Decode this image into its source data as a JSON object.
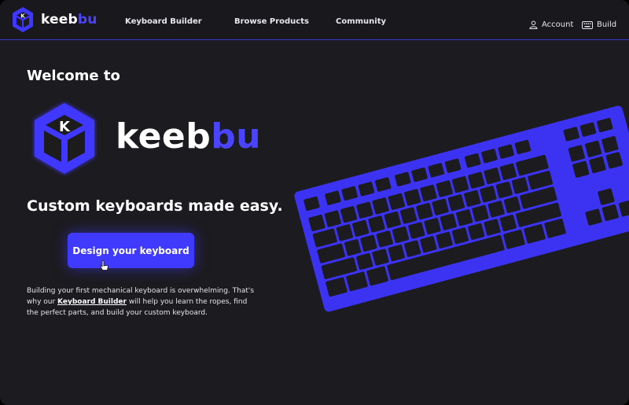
{
  "colors": {
    "accent": "#4b44ff",
    "background": "#1c1b1f",
    "key": "#1c1b1f",
    "button": "#4039ff"
  },
  "header": {
    "logo_icon": "keebbu-hex-logo",
    "brand_pre": "keeb",
    "brand_post": "bu",
    "nav": [
      {
        "label": "Keyboard Builder"
      },
      {
        "label": "Browse Products"
      },
      {
        "label": "Community"
      }
    ],
    "account": {
      "icon": "user-icon",
      "label": "Account"
    },
    "build": {
      "icon": "keyboard-icon",
      "label": "Build"
    }
  },
  "hero": {
    "welcome": "Welcome to",
    "brand_pre": "keeb",
    "brand_post": "bu",
    "tagline": "Custom keyboards made easy.",
    "cta_label": "Design your keyboard",
    "desc_before": "Building your first mechanical keyboard is overwhelming. That's why our ",
    "desc_link": "Keyboard Builder",
    "desc_after": " will help you learn the ropes, find the perfect parts, and build your custom keyboard."
  },
  "illustration": {
    "name": "tenkeyless-keyboard-illustration"
  }
}
